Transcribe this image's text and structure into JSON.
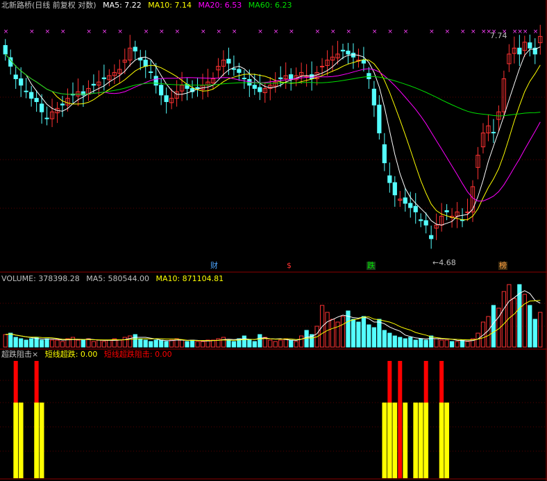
{
  "colors": {
    "background": "#000000",
    "up": "#ff3232",
    "down": "#54ffff",
    "ma5": "#ffffff",
    "ma10": "#ffff00",
    "ma20": "#ff00ff",
    "ma60": "#00e000",
    "grid": "#8b0000",
    "signal_yellow": "#ffff00",
    "signal_red": "#ff0000",
    "text_label": "#c0c0c0"
  },
  "main_panel": {
    "stock_name": "北新路桥",
    "period": "(日线 前复权 对数)",
    "ma5_label": "MA5: 7.22",
    "ma10_label": "MA10: 7.14",
    "ma20_label": "MA20: 6.53",
    "ma60_label": "MA60: 6.23",
    "high_price": "7.74",
    "low_price": "4.68"
  },
  "event_marks": [
    {
      "text": "财",
      "color": "#4da6ff"
    },
    {
      "text": "$",
      "color": "#ff3232"
    },
    {
      "text": "跌",
      "color": "#00e000"
    },
    {
      "text": "榜",
      "color": "#ffa040"
    }
  ],
  "volume_panel": {
    "label": "VOLUME: 378398.28",
    "ma5_label": "MA5: 580544.00",
    "ma10_label": "MA10: 871104.81"
  },
  "indicator_panel": {
    "title": "超跌阻击",
    "close_glyph": "×",
    "short_oversold_label": "短线超跌: 0.00",
    "short_resist_label": "短线超跌阻击: 0.00"
  },
  "chart_data": [
    {
      "type": "candlestick",
      "title": "北新路桥",
      "series": [
        {
          "name": "MA5",
          "value": 7.22
        },
        {
          "name": "MA10",
          "value": 7.14
        },
        {
          "name": "MA20",
          "value": 6.53
        },
        {
          "name": "MA60",
          "value": 6.23
        }
      ],
      "annotations": {
        "high": 7.74,
        "low": 4.68
      },
      "ylim": [
        4.4,
        7.9
      ],
      "closes": [
        7.2,
        7.0,
        6.8,
        6.7,
        6.6,
        6.5,
        6.45,
        6.3,
        6.2,
        6.3,
        6.35,
        6.4,
        6.5,
        6.55,
        6.6,
        6.55,
        6.65,
        6.7,
        6.75,
        6.8,
        6.85,
        6.9,
        6.95,
        7.1,
        7.3,
        7.25,
        7.1,
        7.0,
        6.9,
        6.7,
        6.55,
        6.45,
        6.5,
        6.6,
        6.7,
        6.65,
        6.6,
        6.65,
        6.7,
        6.75,
        6.8,
        7.0,
        7.1,
        7.05,
        6.95,
        6.9,
        6.8,
        6.7,
        6.65,
        6.6,
        6.65,
        6.7,
        6.75,
        6.8,
        6.85,
        6.8,
        6.85,
        6.9,
        6.85,
        6.8,
        6.9,
        7.0,
        7.1,
        7.15,
        7.2,
        7.25,
        7.2,
        7.15,
        7.1,
        7.05,
        6.8,
        6.4,
        6.0,
        5.6,
        5.35,
        5.2,
        5.15,
        5.1,
        5.05,
        5.0,
        4.9,
        4.85,
        4.7,
        4.85,
        4.95,
        5.0,
        4.95,
        5.0,
        4.9,
        5.0,
        5.3,
        5.7,
        6.0,
        6.1,
        6.0,
        6.3,
        6.8,
        7.2,
        7.3,
        7.2,
        7.4,
        7.3,
        7.2,
        7.5
      ]
    },
    {
      "type": "bar",
      "title": "VOLUME",
      "series": [
        {
          "name": "VOLUME",
          "value": 378398.28
        },
        {
          "name": "MA5",
          "value": 580544.0
        },
        {
          "name": "MA10",
          "value": 871104.81
        }
      ],
      "values": [
        9,
        10,
        7,
        6,
        5,
        6,
        7,
        5,
        6,
        5,
        5,
        4,
        6,
        7,
        5,
        5,
        6,
        4,
        5,
        4,
        5,
        6,
        5,
        7,
        8,
        9,
        6,
        5,
        4,
        5,
        5,
        4,
        5,
        6,
        5,
        4,
        5,
        4,
        4,
        5,
        5,
        6,
        7,
        5,
        4,
        6,
        8,
        5,
        4,
        9,
        7,
        5,
        4,
        5,
        6,
        5,
        4,
        8,
        12,
        9,
        15,
        30,
        25,
        20,
        18,
        22,
        26,
        20,
        18,
        22,
        16,
        14,
        20,
        12,
        10,
        8,
        7,
        6,
        7,
        5,
        6,
        5,
        8,
        6,
        5,
        5,
        4,
        4,
        5,
        4,
        6,
        10,
        18,
        22,
        30,
        28,
        40,
        45,
        35,
        45,
        38,
        30,
        20,
        25
      ]
    },
    {
      "type": "bar",
      "title": "超跌阻击",
      "series": [
        {
          "name": "短线超跌",
          "value": 0.0
        },
        {
          "name": "短线超跌阻击",
          "value": 0.0
        }
      ],
      "yellow_signals": [
        0,
        0,
        1,
        1,
        0,
        0,
        1,
        1,
        0,
        0,
        0,
        0,
        0,
        0,
        0,
        0,
        0,
        0,
        0,
        0,
        0,
        0,
        0,
        0,
        0,
        0,
        0,
        0,
        0,
        0,
        0,
        0,
        0,
        0,
        0,
        0,
        0,
        0,
        0,
        0,
        0,
        0,
        0,
        0,
        0,
        0,
        0,
        0,
        0,
        0,
        0,
        0,
        0,
        0,
        0,
        0,
        0,
        0,
        0,
        0,
        0,
        0,
        0,
        0,
        0,
        0,
        0,
        0,
        0,
        0,
        0,
        0,
        0,
        1,
        1,
        1,
        0,
        1,
        0,
        1,
        1,
        1,
        0,
        0,
        1,
        1,
        0,
        0,
        0,
        0,
        0,
        0,
        0,
        0,
        0,
        0,
        0,
        0,
        0,
        0,
        0,
        0,
        0,
        0
      ],
      "red_signals": [
        0,
        0,
        1,
        0,
        0,
        0,
        1,
        0,
        0,
        0,
        0,
        0,
        0,
        0,
        0,
        0,
        0,
        0,
        0,
        0,
        0,
        0,
        0,
        0,
        0,
        0,
        0,
        0,
        0,
        0,
        0,
        0,
        0,
        0,
        0,
        0,
        0,
        0,
        0,
        0,
        0,
        0,
        0,
        0,
        0,
        0,
        0,
        0,
        0,
        0,
        0,
        0,
        0,
        0,
        0,
        0,
        0,
        0,
        0,
        0,
        0,
        0,
        0,
        0,
        0,
        0,
        0,
        0,
        0,
        0,
        0,
        0,
        0,
        0,
        1,
        0,
        1,
        0,
        0,
        0,
        0,
        1,
        0,
        0,
        1,
        0,
        0,
        0,
        0,
        0,
        0,
        0,
        0,
        0,
        0,
        0,
        0,
        0,
        0,
        0,
        0,
        0,
        0,
        0
      ]
    }
  ]
}
